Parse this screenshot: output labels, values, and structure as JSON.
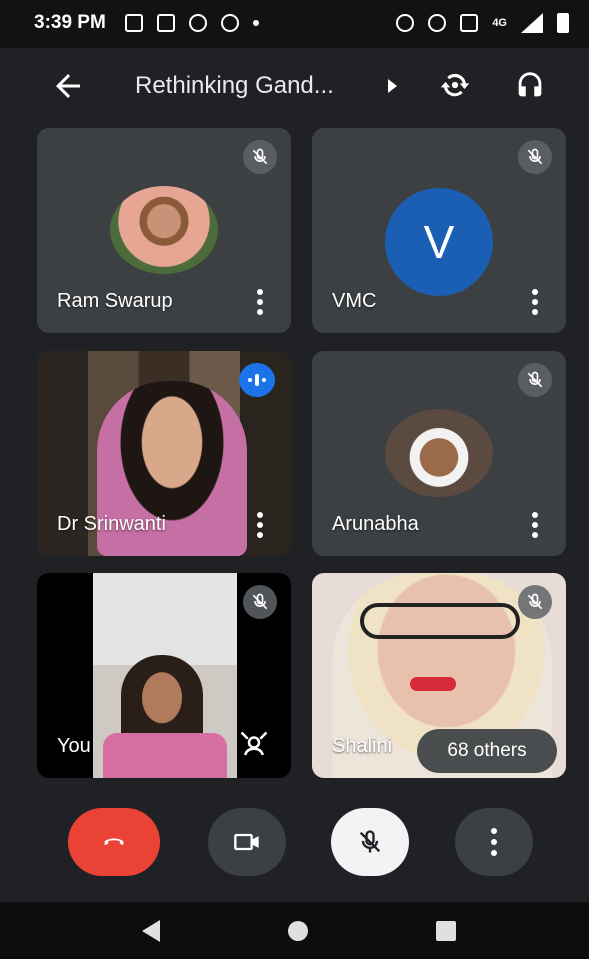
{
  "status_bar": {
    "time": "3:39 PM",
    "network": "4G",
    "icons_left": [
      "gallery-icon",
      "video-icon",
      "whatsapp-icon",
      "person-add-icon",
      "dot-icon"
    ],
    "icons_right": [
      "alarm-icon",
      "headset-icon",
      "volte-icon",
      "signal-icon",
      "battery-icon"
    ]
  },
  "header": {
    "title": "Rethinking Gand...",
    "icons": [
      "back-arrow-icon",
      "switch-camera-icon",
      "audio-output-icon"
    ]
  },
  "tiles": [
    {
      "name": "Ram Swarup",
      "muted": true,
      "avatar": "photo"
    },
    {
      "name": "VMC",
      "muted": true,
      "avatar": "letter",
      "letter": "V",
      "avatar_color": "#1a5fb4"
    },
    {
      "name": "Dr Srinwanti",
      "muted": false,
      "speaking": true,
      "video": true
    },
    {
      "name": "Arunabha",
      "muted": true,
      "avatar": "photo"
    },
    {
      "name": "You",
      "muted": true,
      "video": true
    },
    {
      "name": "Shalini",
      "muted": true,
      "video": true
    }
  ],
  "others_pill": "68 others",
  "controls": {
    "end_call_color": "#ea4335",
    "buttons": [
      "end-call-button",
      "camera-button",
      "microphone-button",
      "more-options-button"
    ]
  },
  "colors": {
    "background": "#202124",
    "tile": "#3c4043",
    "accent": "#1a73e8"
  }
}
